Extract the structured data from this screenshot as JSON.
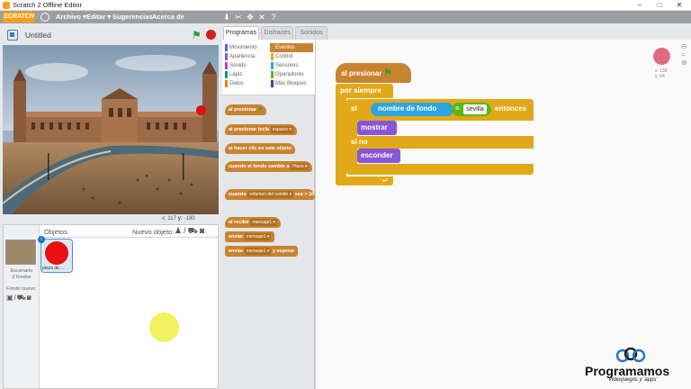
{
  "window": {
    "title": "Scratch 2 Offline Editor",
    "controls": [
      "–",
      "□",
      "✕"
    ]
  },
  "menubar": {
    "logo": "SCRATCH",
    "items": [
      "Archivo ▾",
      "Editar ▾",
      "Sugerencias",
      "Acerca de"
    ],
    "tools": [
      "duplicate-stamp-icon",
      "cut-icon",
      "grow-icon",
      "shrink-icon",
      "help-icon"
    ]
  },
  "stage": {
    "project_title": "Untitled",
    "mouse_x_label": "x:",
    "mouse_x": "117",
    "mouse_y_label": "y:",
    "mouse_y": "-180"
  },
  "sprites": {
    "objetos_label": "Objetos",
    "nuevo_objeto_label": "Nuevo objeto:",
    "stage_label_1": "Escenario",
    "stage_label_2": "2 fondos",
    "fondo_nuevo_label": "Fondo nuevo:",
    "sprite_name": "plaza de ...",
    "colors": {
      "sprite": "#e81010",
      "cursor": "#f0f050"
    }
  },
  "tabs": [
    "Programas",
    "Disfraces",
    "Sonidos"
  ],
  "categories": {
    "left": [
      {
        "label": "Movimiento",
        "color": "#4a6cd4"
      },
      {
        "label": "Apariencia",
        "color": "#8a55d7"
      },
      {
        "label": "Sonido",
        "color": "#bb42c3"
      },
      {
        "label": "Lápiz",
        "color": "#0e9a6c"
      },
      {
        "label": "Datos",
        "color": "#ee7d16"
      }
    ],
    "right": [
      {
        "label": "Eventos",
        "color": "#c88330"
      },
      {
        "label": "Control",
        "color": "#e1a91a"
      },
      {
        "label": "Sensores",
        "color": "#2ca5e2"
      },
      {
        "label": "Operadores",
        "color": "#5cb712"
      },
      {
        "label": "Más Bloques",
        "color": "#632d99"
      }
    ]
  },
  "palette_blocks": {
    "when_flag": "al presionar",
    "when_key": "al presionar tecla",
    "when_key_arg": "espacio ▾",
    "when_clicked": "al hacer clic en este objeto",
    "when_backdrop": "cuando el fondo cambie a",
    "when_backdrop_arg": "Plaza ▾",
    "when_loudness": "cuando",
    "when_loudness_arg": "volumen del sonido ▾",
    "when_loudness_gt": "sea >",
    "when_loudness_val": "10",
    "when_receive": "al recibir",
    "when_receive_arg": "mensaje1 ▾",
    "broadcast": "enviar",
    "broadcast_arg": "mensaje1 ▾",
    "broadcast_wait": "enviar",
    "broadcast_wait_arg": "mensaje1 ▾",
    "broadcast_wait_tail": "y esperar"
  },
  "script": {
    "hat": "al presionar",
    "forever": "por siempre",
    "if": "si",
    "sensing": "nombre de fondo",
    "equals": "=",
    "value": "sevilla",
    "then": "entonces",
    "show": "mostrar",
    "else": "si no",
    "hide": "esconder",
    "xy_x": "x: 135",
    "xy_y": "y: 64",
    "zoom_icons": "⊖ = ⊕"
  },
  "watermark": {
    "brand": "Programamos",
    "tagline": "Videojuegos y 'apps'"
  }
}
